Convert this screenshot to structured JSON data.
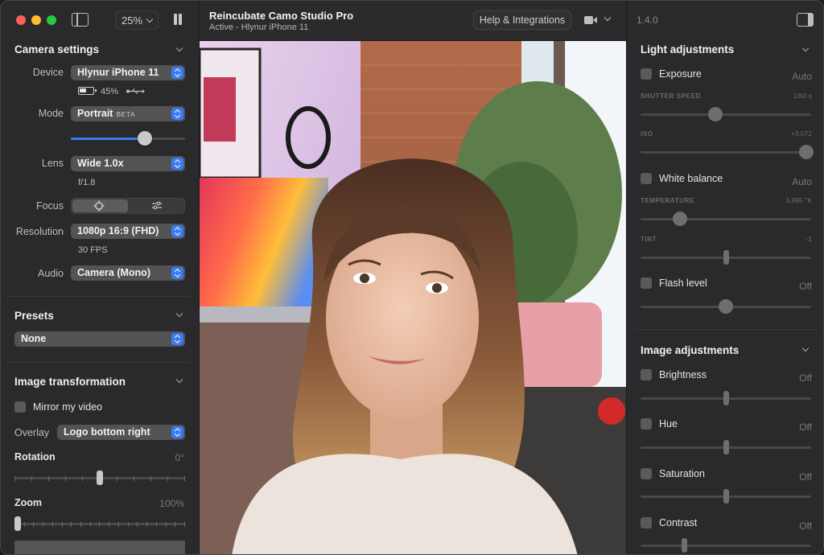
{
  "left": {
    "zoom": "25%",
    "camera_settings": {
      "title": "Camera settings",
      "device_label": "Device",
      "device_value": "Hlynur iPhone 11",
      "battery": "45%",
      "mode_label": "Mode",
      "mode_value": "Portrait",
      "mode_badge": "BETA",
      "mode_slider": 0.65,
      "lens_label": "Lens",
      "lens_value": "Wide 1.0x",
      "aperture": "f/1.8",
      "focus_label": "Focus",
      "resolution_label": "Resolution",
      "resolution_value": "1080p 16:9 (FHD)",
      "fps": "30 FPS",
      "audio_label": "Audio",
      "audio_value": "Camera (Mono)"
    },
    "presets": {
      "title": "Presets",
      "value": "None"
    },
    "image_transformation": {
      "title": "Image transformation",
      "mirror_label": "Mirror my video",
      "overlay_label": "Overlay",
      "overlay_value": "Logo bottom right",
      "rotation_label": "Rotation",
      "rotation_value": "0°",
      "rotation_level": 0.5,
      "zoom_label": "Zoom",
      "zoom_value": "100%",
      "zoom_level": 0.0
    }
  },
  "center": {
    "title": "Reincubate Camo Studio Pro",
    "subtitle": "Active - Hlynur iPhone 11",
    "help_button": "Help & Integrations"
  },
  "right": {
    "version": "1.4.0",
    "light": {
      "title": "Light adjustments",
      "exposure_label": "Exposure",
      "exposure_value": "Auto",
      "shutter_label": "SHUTTER SPEED",
      "shutter_value": "1/60 s",
      "shutter_level": 0.44,
      "iso_label": "ISO",
      "iso_value": "+3,072",
      "iso_level": 0.97,
      "wb_label": "White balance",
      "wb_value": "Auto",
      "temp_label": "TEMPERATURE",
      "temp_value": "3,995 °K",
      "temp_level": 0.23,
      "tint_label": "TINT",
      "tint_value": "-1",
      "tint_level": 0.5,
      "flash_label": "Flash level",
      "flash_value": "Off",
      "flash_level": 0.5
    },
    "image": {
      "title": "Image adjustments",
      "brightness_label": "Brightness",
      "brightness_value": "Off",
      "hue_label": "Hue",
      "hue_value": "Off",
      "saturation_label": "Saturation",
      "saturation_value": "Off",
      "contrast_label": "Contrast",
      "contrast_value": "Off"
    }
  }
}
